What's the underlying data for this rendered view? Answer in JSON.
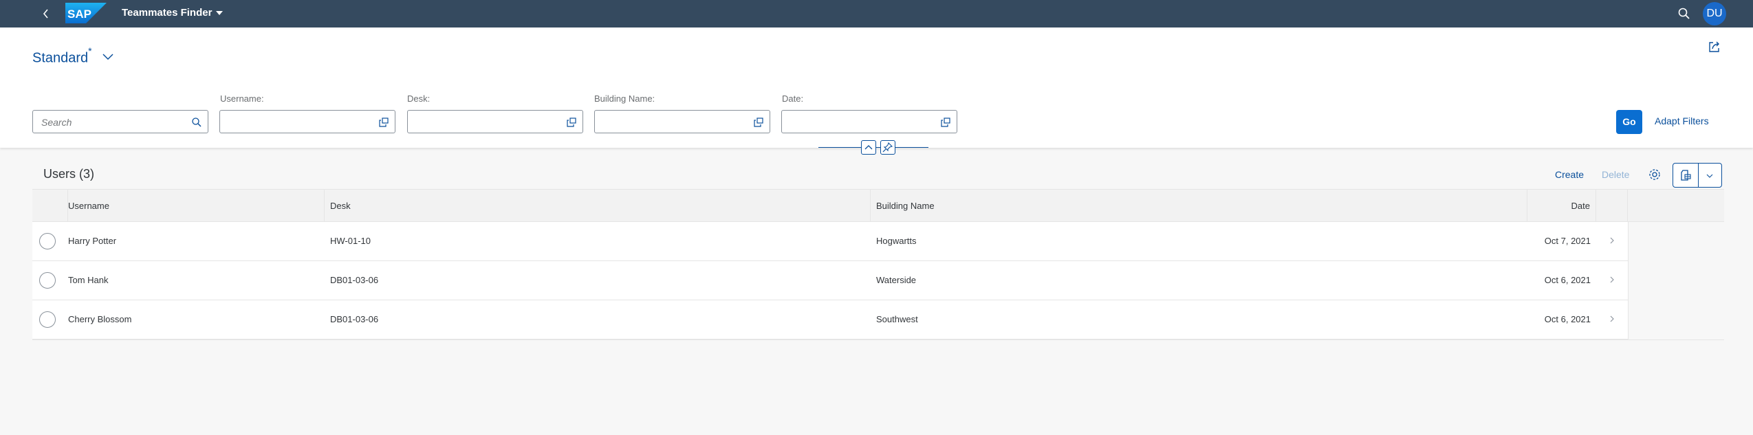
{
  "shell": {
    "back_label": "Back",
    "logo_text": "SAP",
    "app_title": "Teammates Finder",
    "avatar_initials": "DU"
  },
  "header": {
    "variant_name": "Standard",
    "variant_modified": "*"
  },
  "filters": {
    "search_placeholder": "Search",
    "fields": [
      {
        "label": "Username:",
        "value": ""
      },
      {
        "label": "Desk:",
        "value": ""
      },
      {
        "label": "Building Name:",
        "value": ""
      },
      {
        "label": "Date:",
        "value": ""
      }
    ],
    "go_label": "Go",
    "adapt_label": "Adapt Filters"
  },
  "table": {
    "title": "Users (3)",
    "create_label": "Create",
    "delete_label": "Delete",
    "columns": [
      "Username",
      "Desk",
      "Building Name",
      "Date"
    ],
    "rows": [
      {
        "username": "Harry Potter",
        "desk": "HW-01-10",
        "building": "Hogwartts",
        "date": "Oct 7, 2021"
      },
      {
        "username": "Tom Hank",
        "desk": "DB01-03-06",
        "building": "Waterside",
        "date": "Oct 6, 2021"
      },
      {
        "username": "Cherry Blossom",
        "desk": "DB01-03-06",
        "building": "Southwest",
        "date": "Oct 6, 2021"
      }
    ]
  },
  "colors": {
    "shell_bg": "#354a5f",
    "brand_blue": "#0a6ed1",
    "link_blue": "#0a4f9b",
    "disabled_link": "#93b4d6"
  }
}
